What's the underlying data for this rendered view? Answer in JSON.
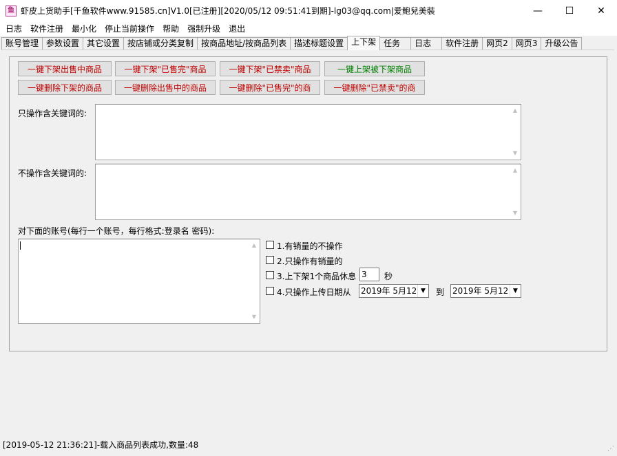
{
  "window": {
    "title": "虾皮上货助手[千鱼软件www.91585.cn]V1.0[已注册][2020/05/12 09:51:41到期]-lg03@qq.com|爱鲍兒美裝",
    "icon_glyph": "鱼",
    "minimize": "—",
    "maximize": "☐",
    "close": "✕"
  },
  "menu": [
    "日志",
    "软件注册",
    "最小化",
    "停止当前操作",
    "帮助",
    "强制升级",
    "退出"
  ],
  "tabs": [
    "账号管理",
    "参数设置",
    "其它设置",
    "按店铺或分类复制",
    "按商品地址/按商品列表",
    "描述标题设置",
    "上下架",
    "任务",
    "日志",
    "软件注册",
    "网页2",
    "网页3",
    "升级公告"
  ],
  "active_tab": "上下架",
  "buttons": {
    "row1": [
      "一键下架出售中商品",
      "一键下架\"已售完\"商品",
      "一键下架\"已禁卖\"商品",
      "一键上架被下架商品"
    ],
    "row2": [
      "一键删除下架的商品",
      "一键删除出售中的商品",
      "一键删除\"已售完\"的商",
      "一键删除\"已禁卖\"的商"
    ]
  },
  "labels": {
    "include_keywords": "只操作含关键词的:",
    "exclude_keywords": "不操作含关键词的:",
    "accounts": "对下面的账号(每行一个账号，每行格式:登录名 密码):"
  },
  "options": {
    "opt1": "1.有销量的不操作",
    "opt2": "2.只操作有销量的",
    "opt3": "3.上下架1个商品休息",
    "opt3_value": "3",
    "opt3_unit": "秒",
    "opt4": "4.只操作上传日期从",
    "date_from": "2019年 5月12日",
    "date_to_label": "到",
    "date_to": "2019年 5月12日"
  },
  "status": "[2019-05-12 21:36:21]-载入商品列表成功,数量:48",
  "colors": {
    "red_text": "#c00000",
    "green_text": "#008000"
  }
}
